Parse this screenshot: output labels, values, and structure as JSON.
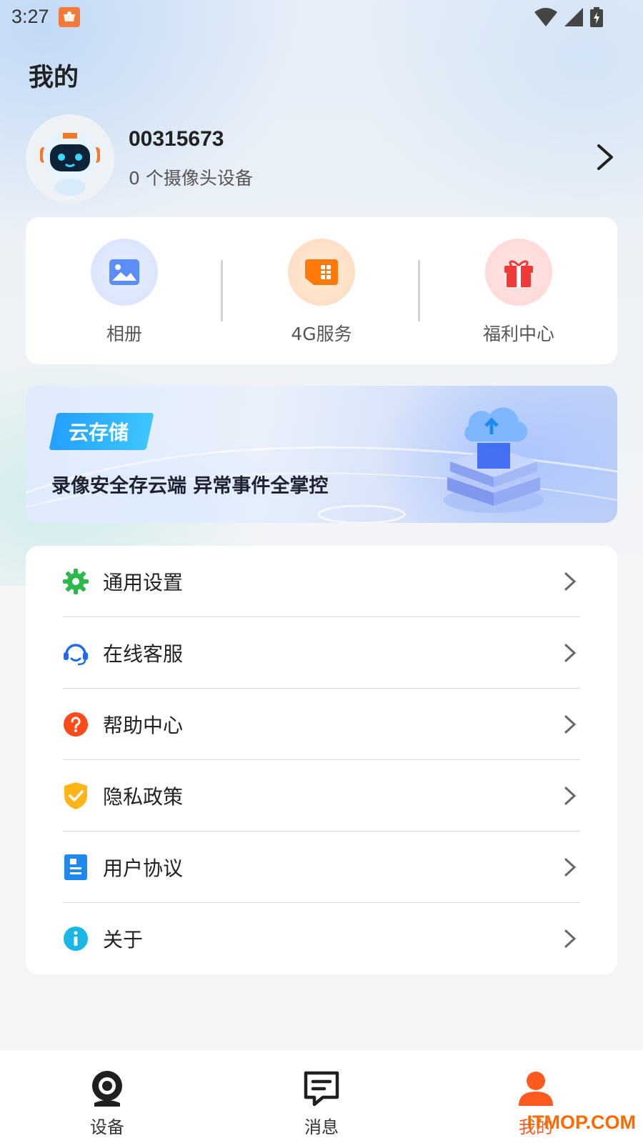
{
  "status_bar": {
    "time": "3:27",
    "icons": [
      "app-notification-icon",
      "wifi-icon",
      "signal-icon",
      "battery-charging-icon"
    ]
  },
  "page_title": "我的",
  "profile": {
    "user_id": "00315673",
    "device_count": "0 个摄像头设备",
    "avatar": "robot-avatar"
  },
  "quick_actions": [
    {
      "label": "相册",
      "icon": "photo-icon",
      "color": "#4d8bf5"
    },
    {
      "label": "4G服务",
      "icon": "sim-card-icon",
      "color": "#ff7a0a"
    },
    {
      "label": "福利中心",
      "icon": "gift-icon",
      "color": "#f03a3a"
    }
  ],
  "banner": {
    "tag": "云存储",
    "subtitle": "录像安全存云端 异常事件全掌控"
  },
  "menu": [
    {
      "label": "通用设置",
      "icon": "gear-icon",
      "color": "#2db84c"
    },
    {
      "label": "在线客服",
      "icon": "headset-icon",
      "color": "#1e6bf0"
    },
    {
      "label": "帮助中心",
      "icon": "question-icon",
      "color": "#ff4a1a"
    },
    {
      "label": "隐私政策",
      "icon": "shield-check-icon",
      "color": "#ffb51a"
    },
    {
      "label": "用户协议",
      "icon": "document-icon",
      "color": "#1e8af0"
    },
    {
      "label": "关于",
      "icon": "info-icon",
      "color": "#19b6e6"
    }
  ],
  "bottom_nav": [
    {
      "label": "设备",
      "icon": "camera-icon",
      "active": false
    },
    {
      "label": "消息",
      "icon": "message-icon",
      "active": false
    },
    {
      "label": "我的",
      "icon": "person-icon",
      "active": true
    }
  ],
  "watermark": "ITMOP.COM",
  "accent_color": "#ff5a1f"
}
